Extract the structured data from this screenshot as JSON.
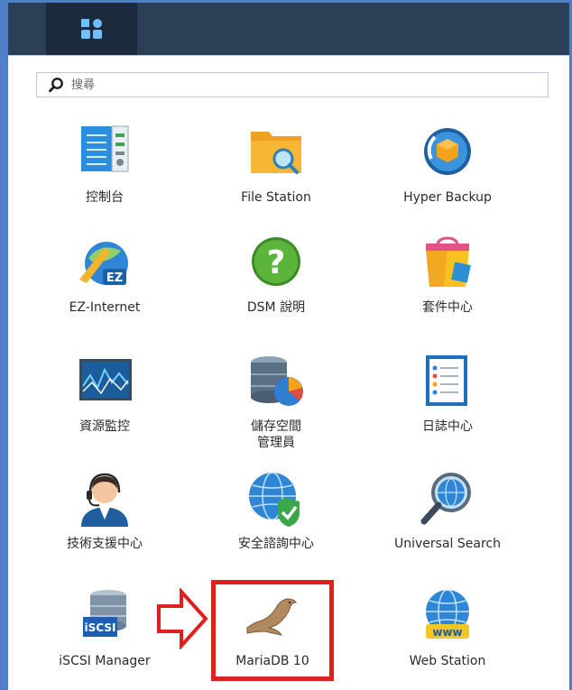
{
  "search": {
    "placeholder": "搜尋"
  },
  "apps": [
    {
      "id": "control-panel",
      "label": "控制台"
    },
    {
      "id": "file-station",
      "label": "File Station"
    },
    {
      "id": "hyper-backup",
      "label": "Hyper Backup"
    },
    {
      "id": "ez-internet",
      "label": "EZ-Internet"
    },
    {
      "id": "dsm-help",
      "label": "DSM 說明"
    },
    {
      "id": "package-center",
      "label": "套件中心"
    },
    {
      "id": "resource-monitor",
      "label": "資源監控"
    },
    {
      "id": "storage-manager",
      "label": "儲存空間\n管理員"
    },
    {
      "id": "log-center",
      "label": "日誌中心"
    },
    {
      "id": "support-center",
      "label": "技術支援中心"
    },
    {
      "id": "security-advisor",
      "label": "安全諮詢中心"
    },
    {
      "id": "universal-search",
      "label": "Universal Search"
    },
    {
      "id": "iscsi-manager",
      "label": "iSCSI Manager",
      "icon_text": "iSCSI"
    },
    {
      "id": "mariadb-10",
      "label": "MariaDB 10"
    },
    {
      "id": "web-station",
      "label": "Web Station",
      "icon_text": "www"
    }
  ],
  "annotation": {
    "highlight_color": "#e0201f",
    "target": "MariaDB 10"
  }
}
